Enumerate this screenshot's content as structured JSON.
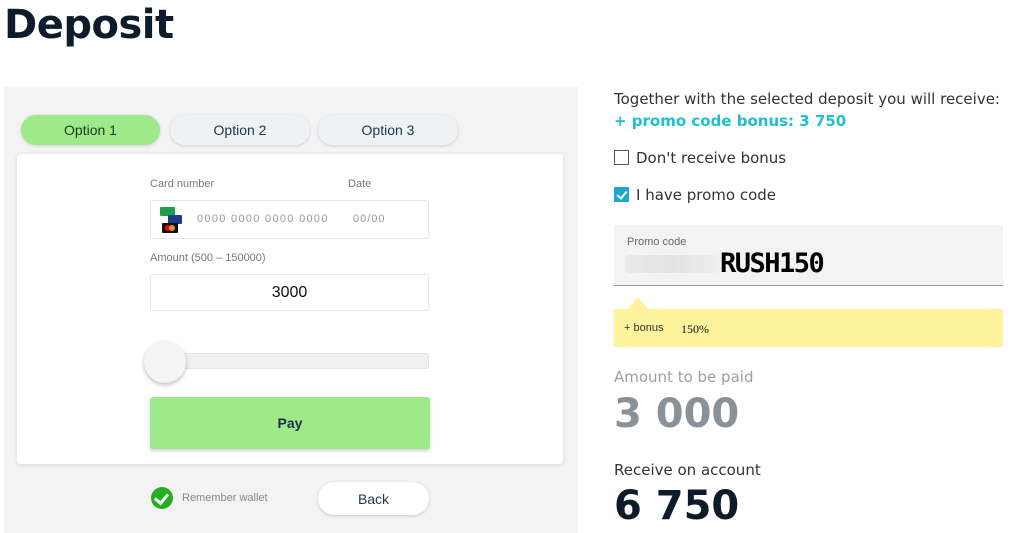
{
  "page": {
    "title": "Deposit"
  },
  "tabs": [
    {
      "label": "Option 1",
      "active": true
    },
    {
      "label": "Option 2",
      "active": false
    },
    {
      "label": "Option 3",
      "active": false
    }
  ],
  "form": {
    "card_label": "Card number",
    "date_label": "Date",
    "card_placeholder": "0000 0000 0000 0000",
    "date_placeholder": "00/00",
    "amount_label": "Amount (500 – 150000)",
    "amount_value": "3000",
    "slider_fraction": 0.0,
    "pay_label": "Pay"
  },
  "footer": {
    "remember_label": "Remember wallet",
    "back_label": "Back"
  },
  "bonus": {
    "together_text": "Together with the selected deposit you will receive:",
    "promo_bonus_text": "+ promo code bonus: 3 750",
    "dont_receive_label": "Don't receive bonus",
    "dont_receive_checked": false,
    "have_promo_label": "I have promo code",
    "have_promo_checked": true,
    "promo_code_label": "Promo code",
    "promo_code_value": "RUSH150",
    "bonus_label": "+ bonus",
    "bonus_value": "150%"
  },
  "summary": {
    "amount_paid_label": "Amount to be paid",
    "amount_paid_value": "3 000",
    "receive_label": "Receive on account",
    "receive_value": "6 750"
  },
  "colors": {
    "active_tab": "#9eea8a",
    "pay_button": "#9eea8a",
    "accent_cyan": "#1fc0d0",
    "checkbox_checked": "#1fa6cf",
    "bonus_highlight": "#fdf39c"
  },
  "icons": [
    "card-brand-icon",
    "visa-icon",
    "mastercard-icon",
    "check-circle-icon",
    "checkbox-icon"
  ]
}
